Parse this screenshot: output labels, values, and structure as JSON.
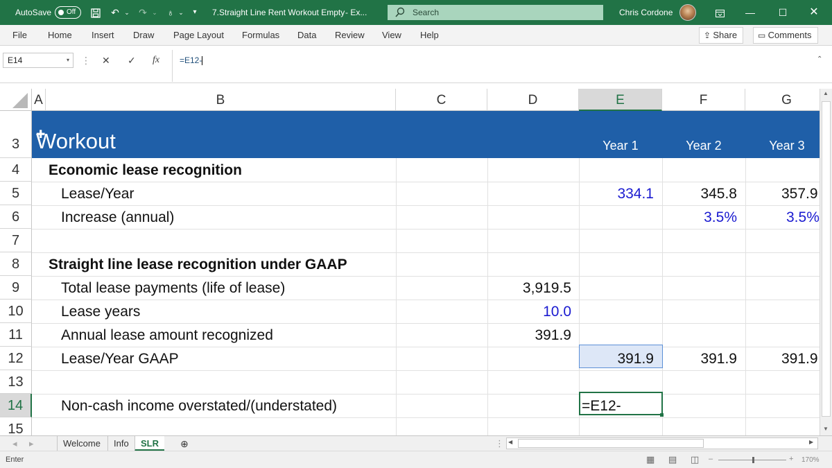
{
  "titlebar": {
    "autosave_label": "AutoSave",
    "autosave_state": "Off",
    "document_title": "7.Straight Line Rent Workout Empty",
    "title_suffix": "-  Ex...",
    "search_placeholder": "Search",
    "user_name": "Chris Cordone"
  },
  "ribbon": {
    "tabs": [
      "File",
      "Home",
      "Insert",
      "Draw",
      "Page Layout",
      "Formulas",
      "Data",
      "Review",
      "View",
      "Help"
    ],
    "share_label": "Share",
    "comments_label": "Comments"
  },
  "formula_bar": {
    "name_box": "E14",
    "formula": "=E12-"
  },
  "grid": {
    "columns": [
      "A",
      "B",
      "C",
      "D",
      "E",
      "F",
      "G"
    ],
    "rows": [
      "3",
      "4",
      "5",
      "6",
      "7",
      "8",
      "9",
      "10",
      "11",
      "12",
      "13",
      "14",
      "15"
    ],
    "selected_column": "E",
    "selected_row": "14",
    "header_title": "Workout",
    "year_headers": [
      "Year 1",
      "Year 2",
      "Year 3"
    ],
    "section1_title": "Economic lease recognition",
    "lease_year_label": "Lease/Year",
    "lease_year_values": [
      "334.1",
      "345.8",
      "357.9"
    ],
    "increase_label": "Increase (annual)",
    "increase_values": [
      "3.5%",
      "3.5%"
    ],
    "section2_title": "Straight line lease recognition under GAAP",
    "total_payments_label": "Total lease payments (life of lease)",
    "total_payments_value": "3,919.5",
    "lease_years_label": "Lease years",
    "lease_years_value": "10.0",
    "annual_amount_label": "Annual lease amount recognized",
    "annual_amount_value": "391.9",
    "gaap_label": "Lease/Year GAAP",
    "gaap_values": [
      "391.9",
      "391.9",
      "391.9"
    ],
    "noncash_label": "Non-cash income overstated/(understated)",
    "editing_value": "=E12-"
  },
  "sheets": {
    "tabs": [
      "Welcome",
      "Info",
      "SLR"
    ],
    "active": "SLR"
  },
  "status": {
    "mode": "Enter",
    "zoom": "170%"
  }
}
